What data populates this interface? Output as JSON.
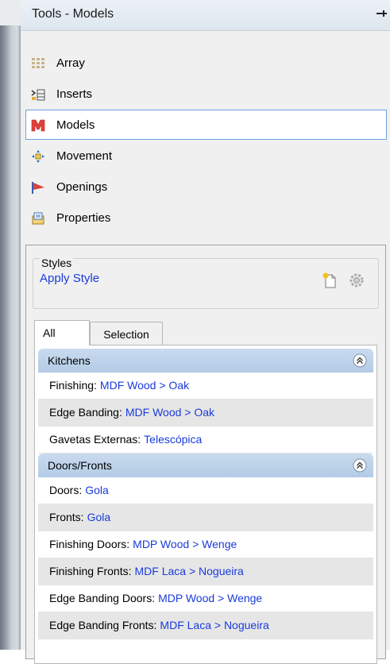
{
  "panel": {
    "title": "Tools - Models",
    "pin_glyph": "—│"
  },
  "tools": [
    {
      "label": "Array",
      "icon": "array-icon"
    },
    {
      "label": "Inserts",
      "icon": "inserts-icon"
    },
    {
      "label": "Models",
      "icon": "models-icon",
      "selected": true
    },
    {
      "label": "Movement",
      "icon": "movement-icon"
    },
    {
      "label": "Openings",
      "icon": "openings-icon"
    },
    {
      "label": "Properties",
      "icon": "properties-icon"
    }
  ],
  "styles": {
    "group_label": "Styles",
    "apply_label": "Apply Style"
  },
  "tabs": [
    {
      "label": "All",
      "active": true
    },
    {
      "label": "Selection",
      "active": false
    }
  ],
  "sections": [
    {
      "title": "Kitchens",
      "rows": [
        {
          "label": "Finishing:",
          "value": "MDF Wood > Oak"
        },
        {
          "label": "Edge Banding:",
          "value": "MDF Wood > Oak"
        },
        {
          "label": "Gavetas Externas:",
          "value": "Telescópica"
        }
      ]
    },
    {
      "title": "Doors/Fronts",
      "rows": [
        {
          "label": "Doors:",
          "value": "Gola"
        },
        {
          "label": "Fronts:",
          "value": "Gola"
        },
        {
          "label": "Finishing Doors:",
          "value": "MDP Wood > Wenge"
        },
        {
          "label": "Finishing Fronts:",
          "value": "MDF Laca > Nogueira"
        },
        {
          "label": "Edge Banding Doors:",
          "value": "MDP Wood > Wenge"
        },
        {
          "label": "Edge Banding Fronts:",
          "value": "MDF Laca > Nogueira"
        }
      ]
    }
  ],
  "colors": {
    "link": "#1a3bdb",
    "selection_border": "#6da3d9",
    "section_header": "#b3cbe6"
  }
}
